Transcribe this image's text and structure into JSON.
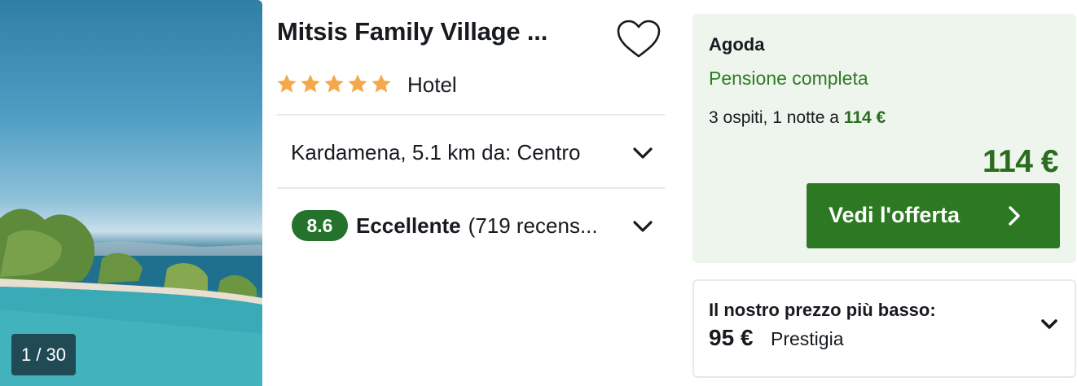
{
  "gallery": {
    "counter": "1 / 30"
  },
  "hotel": {
    "name": "Mitsis Family Village ...",
    "stars": 5,
    "type": "Hotel",
    "location": "Kardamena, 5.1 km da: Centro",
    "rating_score": "8.6",
    "rating_label": "Eccellente",
    "rating_count": "(719 recens..."
  },
  "deal": {
    "provider": "Agoda",
    "board": "Pensione completa",
    "guests_text": "3 ospiti, 1 notte a",
    "guests_price": "114 €",
    "price": "114 €",
    "cta_label": "Vedi l'offerta"
  },
  "lowest": {
    "label": "Il nostro prezzo più basso:",
    "price": "95 €",
    "provider": "Prestigia"
  },
  "colors": {
    "star": "#f4a84a",
    "accent_green": "#2d7822",
    "deal_bg": "#eef5ec",
    "badge_bg": "#24722b"
  },
  "icons": [
    "heart-icon",
    "star-icon",
    "chevron-down-icon",
    "chevron-right-icon"
  ]
}
